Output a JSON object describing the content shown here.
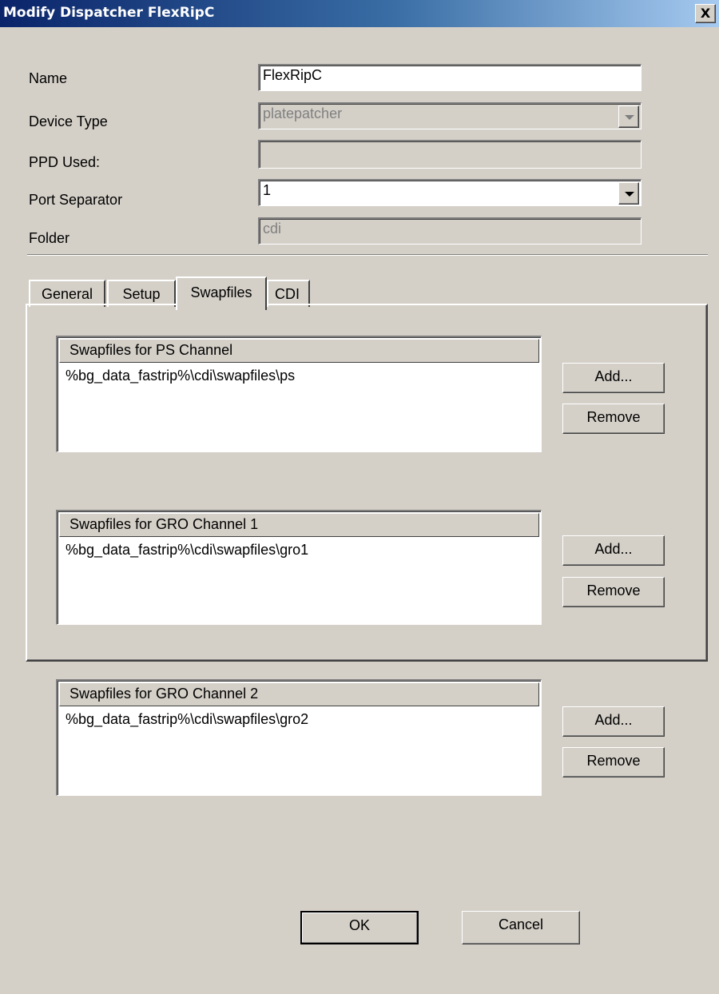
{
  "window": {
    "title": "Modify Dispatcher FlexRipC",
    "close_label": "X"
  },
  "fields": {
    "name": {
      "label": "Name",
      "value": "FlexRipC"
    },
    "device_type": {
      "label": "Device Type",
      "value": "platepatcher"
    },
    "ppd_used": {
      "label": "PPD Used:",
      "value": ""
    },
    "port_separator": {
      "label": "Port Separator",
      "value": "1"
    },
    "folder": {
      "label": "Folder",
      "value": "cdi"
    }
  },
  "tabs": [
    {
      "label": "General",
      "active": false
    },
    {
      "label": "Setup",
      "active": false
    },
    {
      "label": "Swapfiles",
      "active": true
    },
    {
      "label": "CDI",
      "active": false
    }
  ],
  "swapfiles": [
    {
      "header": "Swapfiles for PS Channel",
      "items": [
        "%bg_data_fastrip%\\cdi\\swapfiles\\ps"
      ],
      "add_label": "Add...",
      "remove_label": "Remove"
    },
    {
      "header": "Swapfiles for GRO Channel 1",
      "items": [
        "%bg_data_fastrip%\\cdi\\swapfiles\\gro1"
      ],
      "add_label": "Add...",
      "remove_label": "Remove"
    },
    {
      "header": "Swapfiles for GRO Channel 2",
      "items": [
        "%bg_data_fastrip%\\cdi\\swapfiles\\gro2"
      ],
      "add_label": "Add...",
      "remove_label": "Remove"
    }
  ],
  "footer": {
    "ok_label": "OK",
    "cancel_label": "Cancel"
  },
  "colors": {
    "dialog_bg": "#d4d0c8",
    "titlebar": "#0a246a",
    "disabled_text": "#808080"
  }
}
